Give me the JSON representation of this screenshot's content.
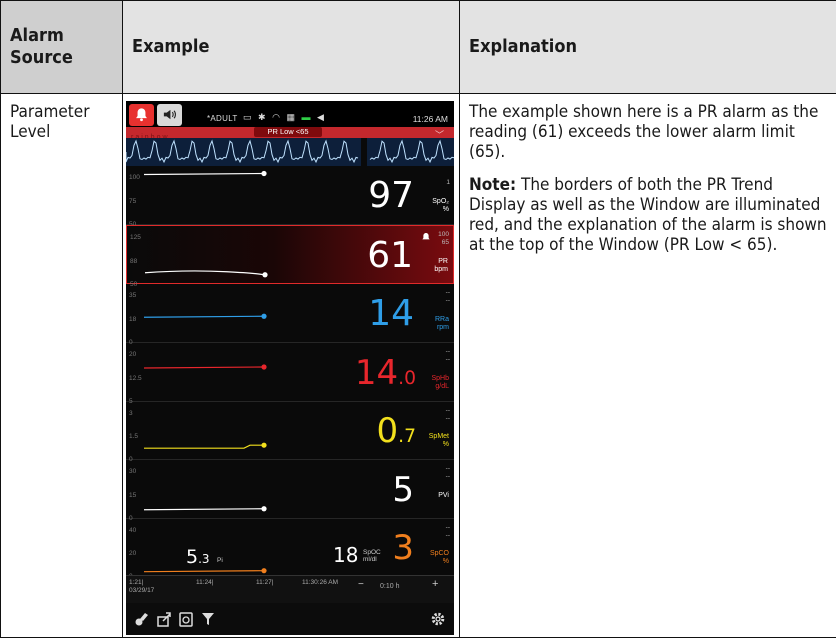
{
  "table": {
    "headers": [
      "Alarm Source",
      "Example",
      "Explanation"
    ],
    "row": {
      "source": "Parameter Level",
      "explanation_p1": "The example shown here is a PR alarm as the reading (61) exceeds the lower alarm limit (65).",
      "note_label": "Note:",
      "note_text": " The borders of both the PR Trend Display as well as the Window are illuminated red, and the explanation of the alarm is shown at the top of the Window (PR Low < 65)."
    }
  },
  "screen": {
    "mode": "*ADULT",
    "clock": "11:26 AM",
    "banner_brand": "rainbow",
    "alarm_message": "PR Low <65",
    "params": [
      {
        "id": "spo2",
        "value": "97",
        "decimal": "",
        "label": "SpO₂",
        "unit": "%",
        "limit_hi": "",
        "limit_lo": "1",
        "color": "#ffffff",
        "ticks": [
          "100",
          "75",
          "50"
        ],
        "trend": 0.9
      },
      {
        "id": "pr",
        "value": "61",
        "decimal": "",
        "label": "PR",
        "unit": "bpm",
        "limit_hi": "100",
        "limit_lo": "65",
        "color": "#ffffff",
        "ticks": [
          "125",
          "88",
          "50"
        ],
        "trend": 0.15
      },
      {
        "id": "rra",
        "value": "14",
        "decimal": "",
        "label": "RRa",
        "unit": "rpm",
        "limit_hi": "--",
        "limit_lo": "--",
        "color": "#2f9ee8",
        "ticks": [
          "35",
          "18",
          "0"
        ],
        "trend": 0.45
      },
      {
        "id": "sphb",
        "value": "14",
        "decimal": ".0",
        "label": "SpHb",
        "unit": "g/dL",
        "limit_hi": "--",
        "limit_lo": "--",
        "color": "#e8262c",
        "ticks": [
          "20",
          "12.5",
          "5"
        ],
        "trend": 0.6
      },
      {
        "id": "spmet",
        "value": "0",
        "decimal": ".7",
        "label": "SpMet",
        "unit": "%",
        "limit_hi": "--",
        "limit_lo": "--",
        "color": "#f2e01d",
        "ticks": [
          "3",
          "1.5",
          "0"
        ],
        "trend": 0.2
      },
      {
        "id": "pvi",
        "value": "5",
        "decimal": "",
        "label": "PVi",
        "unit": "",
        "limit_hi": "--",
        "limit_lo": "--",
        "color": "#ffffff",
        "ticks": [
          "30",
          "15",
          "0"
        ],
        "trend": 0.15
      },
      {
        "id": "spco",
        "value": "3",
        "decimal": "",
        "label": "SpCO",
        "unit": "%",
        "limit_hi": "--",
        "limit_lo": "--",
        "color": "#f07f1e",
        "ticks": [
          "40",
          "20",
          "0"
        ],
        "trend": 0.08
      }
    ],
    "pi": {
      "value": "5",
      "decimal": ".3",
      "label": "Pi"
    },
    "spoc": {
      "value": "18",
      "label": "SpOC",
      "unit": "ml/dl"
    },
    "timeline": {
      "t0": "1:21|",
      "date": "03/29/17",
      "t1": "11:24|",
      "t2": "11:27|",
      "t3": "11:30:26 AM",
      "zoom_minus": "−",
      "zoom": "0:10 h",
      "zoom_plus": "+"
    }
  }
}
